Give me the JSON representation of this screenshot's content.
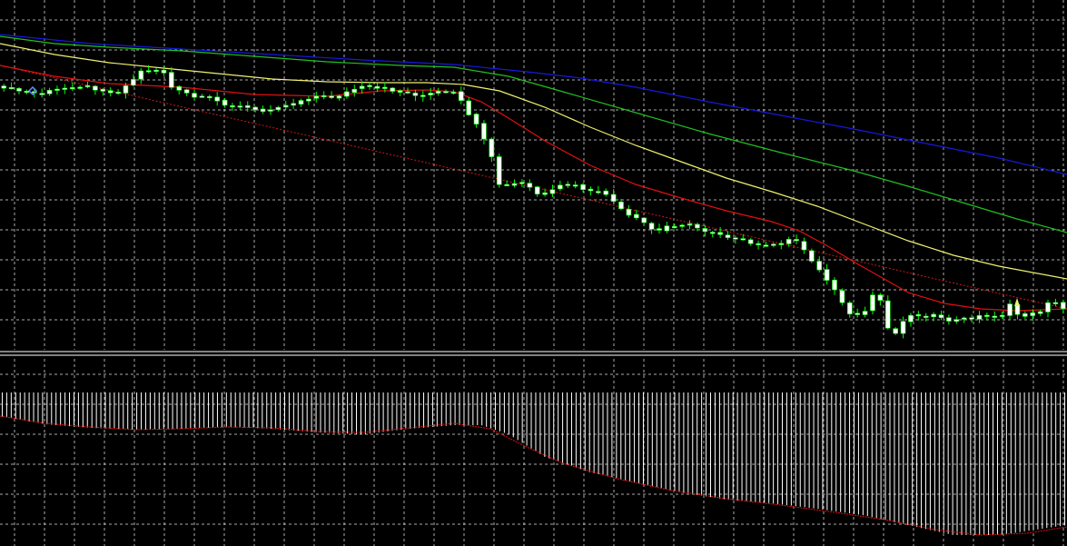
{
  "colors": {
    "background": "#000000",
    "grid": "#c8c8c8",
    "candle_bull": "#ffffff",
    "candle_bear": "#ffffff",
    "wick": "#00ff00",
    "ma_red": "#e01010",
    "ma_yellow": "#f0f070",
    "ma_green": "#20c020",
    "ma_blue": "#1818e0",
    "trendline": "#d01818",
    "separator": "#ffffff",
    "histogram": "#ffffff",
    "signal": "#e01010",
    "marker_blue": "#6a8cff",
    "marker_yellow": "#f0f070"
  },
  "chart_data": [
    {
      "type": "candlestick",
      "panel": "main",
      "grid": true,
      "axis_labels": "none",
      "candle_count": 140,
      "price_path": [
        [
          0,
          95
        ],
        [
          10,
          96
        ],
        [
          20,
          99
        ],
        [
          30,
          101
        ],
        [
          40,
          102
        ],
        [
          50,
          103
        ],
        [
          60,
          100
        ],
        [
          70,
          98
        ],
        [
          80,
          96
        ],
        [
          90,
          95
        ],
        [
          100,
          95
        ],
        [
          110,
          98
        ],
        [
          120,
          100
        ],
        [
          130,
          104
        ],
        [
          140,
          97
        ],
        [
          150,
          88
        ],
        [
          160,
          78
        ],
        [
          170,
          77
        ],
        [
          180,
          77
        ],
        [
          185,
          80
        ],
        [
          190,
          95
        ],
        [
          200,
          100
        ],
        [
          210,
          103
        ],
        [
          220,
          108
        ],
        [
          230,
          107
        ],
        [
          240,
          110
        ],
        [
          250,
          114
        ],
        [
          260,
          116
        ],
        [
          270,
          118
        ],
        [
          280,
          119
        ],
        [
          290,
          124
        ],
        [
          300,
          120
        ],
        [
          310,
          117
        ],
        [
          320,
          116
        ],
        [
          330,
          112
        ],
        [
          340,
          109
        ],
        [
          350,
          106
        ],
        [
          360,
          106
        ],
        [
          370,
          107
        ],
        [
          380,
          104
        ],
        [
          390,
          100
        ],
        [
          400,
          96
        ],
        [
          410,
          96
        ],
        [
          420,
          98
        ],
        [
          430,
          97
        ],
        [
          440,
          101
        ],
        [
          450,
          102
        ],
        [
          460,
          104
        ],
        [
          470,
          105
        ],
        [
          480,
          103
        ],
        [
          490,
          100
        ],
        [
          500,
          103
        ],
        [
          505,
          102
        ],
        [
          510,
          108
        ],
        [
          515,
          118
        ],
        [
          520,
          125
        ],
        [
          530,
          140
        ],
        [
          540,
          160
        ],
        [
          548,
          180
        ],
        [
          555,
          207
        ],
        [
          565,
          203
        ],
        [
          575,
          202
        ],
        [
          585,
          200
        ],
        [
          590,
          213
        ],
        [
          600,
          214
        ],
        [
          610,
          212
        ],
        [
          620,
          205
        ],
        [
          630,
          203
        ],
        [
          640,
          205
        ],
        [
          650,
          210
        ],
        [
          660,
          212
        ],
        [
          670,
          212
        ],
        [
          680,
          222
        ],
        [
          690,
          233
        ],
        [
          700,
          240
        ],
        [
          710,
          242
        ],
        [
          720,
          252
        ],
        [
          730,
          254
        ],
        [
          740,
          248
        ],
        [
          750,
          248
        ],
        [
          760,
          246
        ],
        [
          770,
          250
        ],
        [
          780,
          254
        ],
        [
          790,
          256
        ],
        [
          800,
          258
        ],
        [
          810,
          262
        ],
        [
          820,
          264
        ],
        [
          830,
          268
        ],
        [
          840,
          270
        ],
        [
          850,
          268
        ],
        [
          860,
          273
        ],
        [
          870,
          264
        ],
        [
          880,
          262
        ],
        [
          890,
          276
        ],
        [
          900,
          290
        ],
        [
          910,
          300
        ],
        [
          920,
          315
        ],
        [
          930,
          330
        ],
        [
          940,
          347
        ],
        [
          950,
          348
        ],
        [
          960,
          340
        ],
        [
          965,
          325
        ],
        [
          970,
          320
        ],
        [
          975,
          335
        ],
        [
          980,
          358
        ],
        [
          990,
          368
        ],
        [
          1000,
          350
        ],
        [
          1010,
          347
        ],
        [
          1020,
          347
        ],
        [
          1030,
          346
        ],
        [
          1040,
          351
        ],
        [
          1050,
          353
        ],
        [
          1060,
          352
        ],
        [
          1070,
          350
        ],
        [
          1080,
          348
        ],
        [
          1090,
          348
        ],
        [
          1100,
          347
        ],
        [
          1110,
          346
        ],
        [
          1115,
          337
        ],
        [
          1120,
          333
        ],
        [
          1125,
          347
        ],
        [
          1130,
          348
        ],
        [
          1140,
          346
        ],
        [
          1150,
          342
        ],
        [
          1160,
          330
        ],
        [
          1175,
          340
        ]
      ],
      "moving_averages": [
        {
          "name": "",
          "color": "ma_red",
          "path": [
            [
              0,
              72
            ],
            [
              60,
              84
            ],
            [
              120,
              92
            ],
            [
              200,
              96
            ],
            [
              280,
              104
            ],
            [
              360,
              106
            ],
            [
              420,
              100
            ],
            [
              470,
              99
            ],
            [
              500,
              101
            ],
            [
              530,
              112
            ],
            [
              560,
              130
            ],
            [
              600,
              155
            ],
            [
              650,
              182
            ],
            [
              700,
              203
            ],
            [
              750,
              218
            ],
            [
              800,
              232
            ],
            [
              850,
              244
            ],
            [
              880,
              254
            ],
            [
              910,
              270
            ],
            [
              940,
              288
            ],
            [
              970,
              305
            ],
            [
              1000,
              322
            ],
            [
              1040,
              334
            ],
            [
              1080,
              340
            ],
            [
              1120,
              342
            ],
            [
              1175,
              340
            ]
          ]
        },
        {
          "name": "",
          "color": "ma_yellow",
          "path": [
            [
              0,
              48
            ],
            [
              60,
              60
            ],
            [
              120,
              69
            ],
            [
              180,
              75
            ],
            [
              240,
              81
            ],
            [
              300,
              87
            ],
            [
              360,
              90
            ],
            [
              420,
              91
            ],
            [
              470,
              91
            ],
            [
              510,
              93
            ],
            [
              550,
              100
            ],
            [
              600,
              118
            ],
            [
              650,
              140
            ],
            [
              700,
              160
            ],
            [
              750,
              178
            ],
            [
              800,
              196
            ],
            [
              850,
              211
            ],
            [
              900,
              227
            ],
            [
              950,
              246
            ],
            [
              1000,
              265
            ],
            [
              1050,
              281
            ],
            [
              1100,
              293
            ],
            [
              1175,
              307
            ]
          ]
        },
        {
          "name": "",
          "color": "ma_green",
          "path": [
            [
              0,
              40
            ],
            [
              60,
              48
            ],
            [
              120,
              52
            ],
            [
              200,
              56
            ],
            [
              280,
              62
            ],
            [
              360,
              68
            ],
            [
              440,
              72
            ],
            [
              500,
              74
            ],
            [
              560,
              84
            ],
            [
              620,
              101
            ],
            [
              700,
              124
            ],
            [
              780,
              147
            ],
            [
              860,
              168
            ],
            [
              940,
              188
            ],
            [
              1000,
              205
            ],
            [
              1060,
              223
            ],
            [
              1120,
              241
            ],
            [
              1175,
              256
            ]
          ]
        },
        {
          "name": "",
          "color": "ma_blue",
          "path": [
            [
              0,
              38
            ],
            [
              100,
              48
            ],
            [
              200,
              54
            ],
            [
              300,
              60
            ],
            [
              400,
              66
            ],
            [
              500,
              71
            ],
            [
              580,
              79
            ],
            [
              640,
              86
            ],
            [
              700,
              96
            ],
            [
              780,
              112
            ],
            [
              860,
              127
            ],
            [
              940,
              142
            ],
            [
              1020,
              158
            ],
            [
              1100,
              174
            ],
            [
              1175,
              192
            ]
          ]
        }
      ],
      "trendline": {
        "from": [
          0,
          72
        ],
        "to": [
          1175,
          340
        ],
        "style": "dotted"
      }
    },
    {
      "type": "histogram",
      "panel": "sub",
      "grid": true,
      "axis_labels": "none",
      "bar_count": 238,
      "hist_path": [
        [
          0,
          458
        ],
        [
          50,
          467
        ],
        [
          100,
          471
        ],
        [
          150,
          473
        ],
        [
          200,
          472
        ],
        [
          250,
          470
        ],
        [
          300,
          472
        ],
        [
          350,
          476
        ],
        [
          400,
          478
        ],
        [
          450,
          472
        ],
        [
          500,
          468
        ],
        [
          530,
          468
        ],
        [
          560,
          478
        ],
        [
          600,
          503
        ],
        [
          650,
          520
        ],
        [
          700,
          531
        ],
        [
          750,
          542
        ],
        [
          800,
          550
        ],
        [
          850,
          554
        ],
        [
          900,
          560
        ],
        [
          950,
          567
        ],
        [
          1000,
          578
        ],
        [
          1050,
          589
        ],
        [
          1100,
          589
        ],
        [
          1175,
          578
        ]
      ],
      "signal_path": [
        [
          0,
          458
        ],
        [
          50,
          466
        ],
        [
          100,
          470
        ],
        [
          150,
          473
        ],
        [
          200,
          472
        ],
        [
          250,
          470
        ],
        [
          300,
          471
        ],
        [
          350,
          475
        ],
        [
          400,
          476
        ],
        [
          450,
          471
        ],
        [
          500,
          466
        ],
        [
          540,
          472
        ],
        [
          580,
          492
        ],
        [
          620,
          510
        ],
        [
          680,
          527
        ],
        [
          740,
          540
        ],
        [
          800,
          549
        ],
        [
          860,
          556
        ],
        [
          920,
          564
        ],
        [
          980,
          573
        ],
        [
          1030,
          583
        ],
        [
          1080,
          589
        ],
        [
          1130,
          587
        ],
        [
          1175,
          580
        ]
      ]
    }
  ]
}
